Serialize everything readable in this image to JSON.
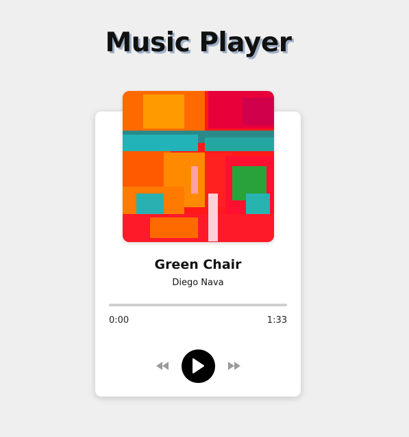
{
  "page": {
    "title": "Music Player"
  },
  "track": {
    "title": "Green Chair",
    "artist": "Diego Nava",
    "current_time": "0:00",
    "duration": "1:33",
    "progress": 0
  },
  "controls": {
    "rewind_icon": "rewind-icon",
    "play_icon": "play-icon",
    "forward_icon": "fast-forward-icon"
  },
  "colors": {
    "background": "#efefef",
    "card": "#ffffff",
    "title_shadow": "#9fb0c8",
    "progress_track": "#cfcfcf",
    "control_inactive": "#9a9a9a",
    "play_button": "#000000"
  }
}
